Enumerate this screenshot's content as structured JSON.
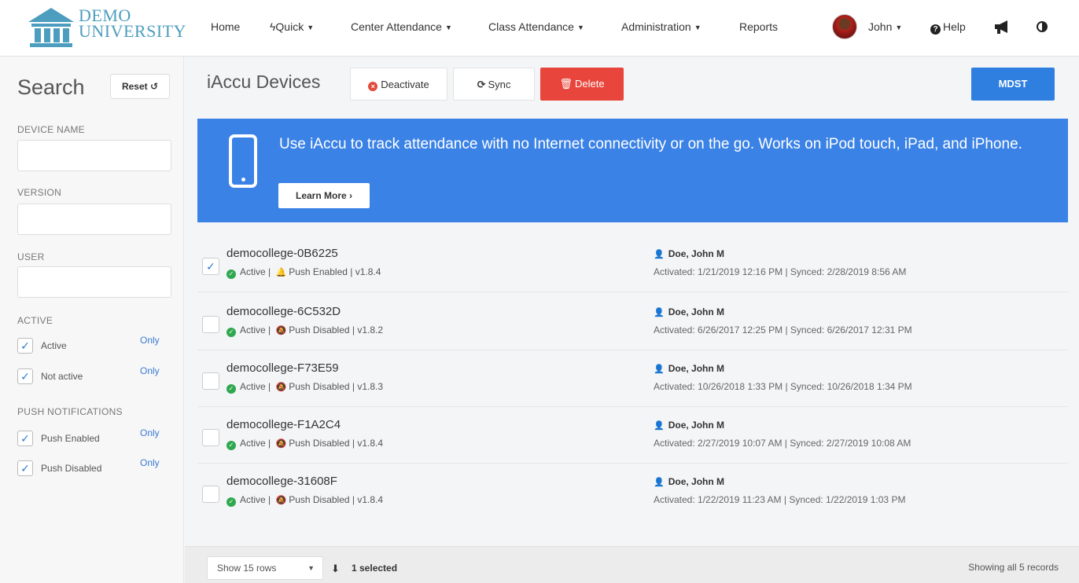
{
  "logo": {
    "line1": "DEMO",
    "line2": "UNIVERSITY"
  },
  "nav": {
    "home": "Home",
    "quick": "Quick",
    "center_attendance": "Center Attendance",
    "class_attendance": "Class Attendance",
    "administration": "Administration",
    "reports": "Reports",
    "user": "John",
    "help": "Help"
  },
  "sidebar": {
    "title": "Search",
    "reset": "Reset",
    "device_name_label": "DEVICE NAME",
    "version_label": "VERSION",
    "user_label": "USER",
    "active_label": "ACTIVE",
    "active_options": [
      {
        "label": "Active",
        "only": "Only",
        "checked": "✓"
      },
      {
        "label": "Not active",
        "only": "Only",
        "checked": "✓"
      }
    ],
    "push_label": "PUSH NOTIFICATIONS",
    "push_options": [
      {
        "label": "Push Enabled",
        "only": "Only",
        "checked": "✓"
      },
      {
        "label": "Push Disabled",
        "only": "Only",
        "checked": "✓"
      }
    ]
  },
  "header": {
    "title": "iAccu Devices",
    "deactivate": "Deactivate",
    "sync": "Sync",
    "delete": "Delete",
    "mdst": "MDST"
  },
  "banner": {
    "text": "Use iAccu to track attendance with no Internet connectivity or on the go. Works on iPod touch, iPad, and iPhone.",
    "button": "Learn More ›"
  },
  "devices": [
    {
      "name": "democollege-0B6225",
      "status": "Active",
      "push": "Push Enabled",
      "version": "v1.8.4",
      "user": "Doe, John M",
      "dates": "Activated: 1/21/2019 12:16 PM | Synced: 2/28/2019 8:56 AM",
      "check": "✓"
    },
    {
      "name": "democollege-6C532D",
      "status": "Active",
      "push": "Push Disabled",
      "version": "v1.8.2",
      "user": "Doe, John M",
      "dates": "Activated: 6/26/2017 12:25 PM | Synced: 6/26/2017 12:31 PM",
      "check": ""
    },
    {
      "name": "democollege-F73E59",
      "status": "Active",
      "push": "Push Disabled",
      "version": "v1.8.3",
      "user": "Doe, John M",
      "dates": "Activated: 10/26/2018 1:33 PM | Synced: 10/26/2018 1:34 PM",
      "check": ""
    },
    {
      "name": "democollege-F1A2C4",
      "status": "Active",
      "push": "Push Disabled",
      "version": "v1.8.4",
      "user": "Doe, John M",
      "dates": "Activated: 2/27/2019 10:07 AM | Synced: 2/27/2019 10:08 AM",
      "check": ""
    },
    {
      "name": "democollege-31608F",
      "status": "Active",
      "push": "Push Disabled",
      "version": "v1.8.4",
      "user": "Doe, John M",
      "dates": "Activated: 1/22/2019 11:23 AM | Synced: 1/22/2019 1:03 PM",
      "check": ""
    }
  ],
  "footer": {
    "rows": "Show 15 rows",
    "selected": "1 selected",
    "records": "Showing all 5 records"
  },
  "colors": {
    "banner": "#3b82e6",
    "delete": "#e8453c",
    "mdst": "#2f7fe0",
    "logo": "#4d9dbf",
    "active_ok": "#2fa84f"
  }
}
